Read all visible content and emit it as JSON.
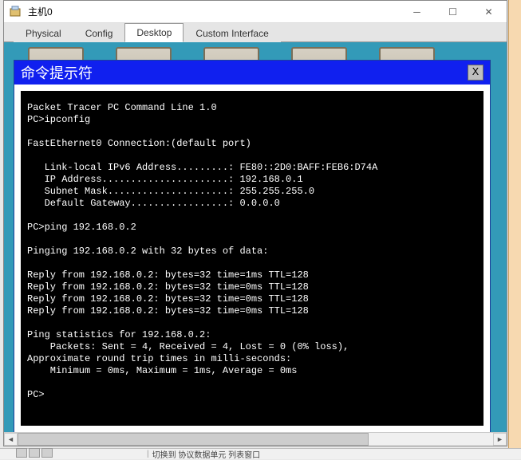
{
  "window": {
    "title": "主机0"
  },
  "tabs": {
    "physical": "Physical",
    "config": "Config",
    "desktop": "Desktop",
    "custom": "Custom Interface"
  },
  "cmd": {
    "title": "命令提示符",
    "close": "X"
  },
  "terminal": {
    "lines": "Packet Tracer PC Command Line 1.0\nPC>ipconfig\n\nFastEthernet0 Connection:(default port)\n\n   Link-local IPv6 Address.........: FE80::2D0:BAFF:FEB6:D74A\n   IP Address......................: 192.168.0.1\n   Subnet Mask.....................: 255.255.255.0\n   Default Gateway.................: 0.0.0.0\n\nPC>ping 192.168.0.2\n\nPinging 192.168.0.2 with 32 bytes of data:\n\nReply from 192.168.0.2: bytes=32 time=1ms TTL=128\nReply from 192.168.0.2: bytes=32 time=0ms TTL=128\nReply from 192.168.0.2: bytes=32 time=0ms TTL=128\nReply from 192.168.0.2: bytes=32 time=0ms TTL=128\n\nPing statistics for 192.168.0.2:\n    Packets: Sent = 4, Received = 4, Lost = 0 (0% loss),\nApproximate round trip times in milli-seconds:\n    Minimum = 0ms, Maximum = 1ms, Average = 0ms\n\nPC>"
  },
  "statusbar": {
    "text": "切换到 协议数据单元 列表窗口"
  }
}
